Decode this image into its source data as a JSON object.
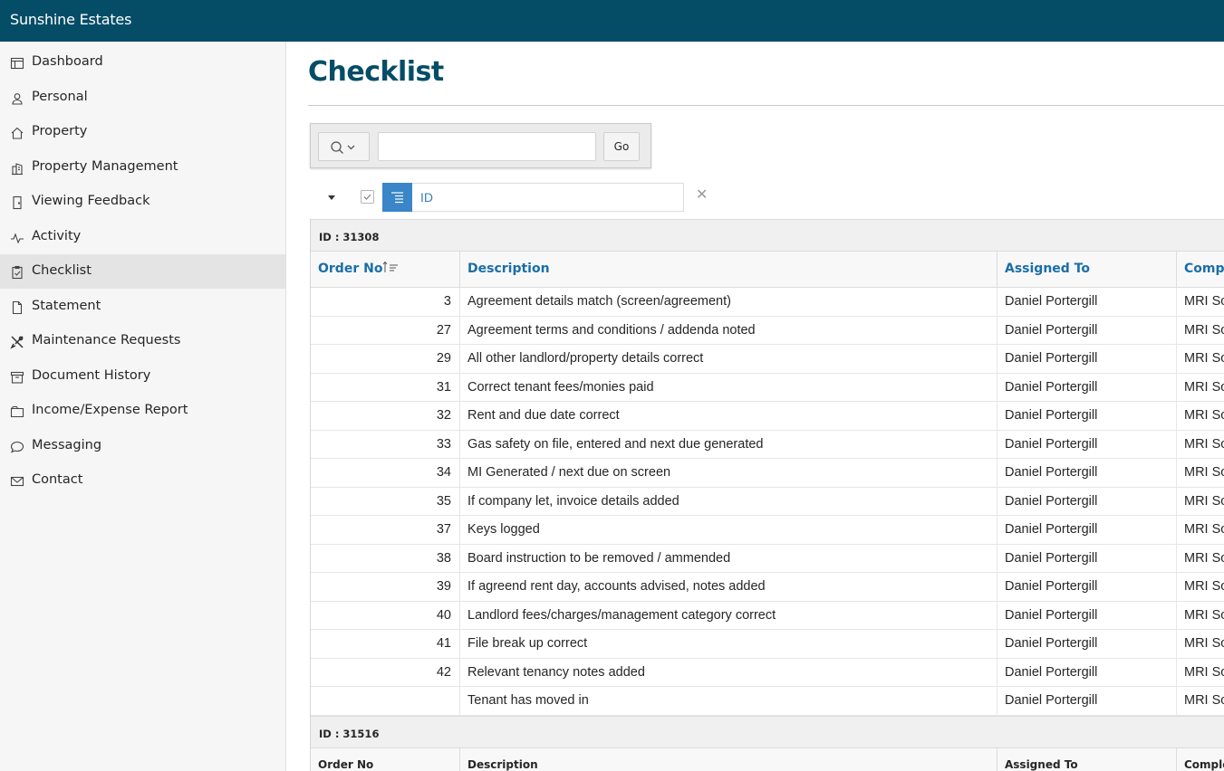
{
  "app": {
    "title": "Sunshine Estates"
  },
  "sidebar": {
    "items": [
      {
        "label": "Dashboard",
        "icon": "dashboard-icon",
        "active": false
      },
      {
        "label": "Personal",
        "icon": "user-icon",
        "active": false
      },
      {
        "label": "Property",
        "icon": "home-icon",
        "active": false
      },
      {
        "label": "Property Management",
        "icon": "building-icon",
        "active": false
      },
      {
        "label": "Viewing Feedback",
        "icon": "door-icon",
        "active": false
      },
      {
        "label": "Activity",
        "icon": "pulse-icon",
        "active": false
      },
      {
        "label": "Checklist",
        "icon": "clipboard-icon",
        "active": true
      },
      {
        "label": "Statement",
        "icon": "file-icon",
        "active": false
      },
      {
        "label": "Maintenance Requests",
        "icon": "tools-icon",
        "active": false
      },
      {
        "label": "Document History",
        "icon": "archive-icon",
        "active": false
      },
      {
        "label": "Income/Expense Report",
        "icon": "folder-icon",
        "active": false
      },
      {
        "label": "Messaging",
        "icon": "chat-icon",
        "active": false
      },
      {
        "label": "Contact",
        "icon": "mail-icon",
        "active": false
      }
    ]
  },
  "page": {
    "title": "Checklist"
  },
  "search": {
    "value": "",
    "go_label": "Go"
  },
  "filter": {
    "label": "ID",
    "checked": true
  },
  "columns": {
    "order": "Order No",
    "description": "Description",
    "assigned": "Assigned To",
    "completed": "Compl"
  },
  "groups": [
    {
      "header": "ID : 31308",
      "rows": [
        {
          "order": "3",
          "description": "Agreement details match (screen/agreement)",
          "assigned": "Daniel Portergill",
          "completed": "MRI So"
        },
        {
          "order": "27",
          "description": "Agreement terms and conditions / addenda noted",
          "assigned": "Daniel Portergill",
          "completed": "MRI So"
        },
        {
          "order": "29",
          "description": "All other landlord/property details correct",
          "assigned": "Daniel Portergill",
          "completed": "MRI So"
        },
        {
          "order": "31",
          "description": "Correct tenant fees/monies paid",
          "assigned": "Daniel Portergill",
          "completed": "MRI So"
        },
        {
          "order": "32",
          "description": "Rent and due date correct",
          "assigned": "Daniel Portergill",
          "completed": "MRI So"
        },
        {
          "order": "33",
          "description": "Gas safety on file, entered and next due generated",
          "assigned": "Daniel Portergill",
          "completed": "MRI So"
        },
        {
          "order": "34",
          "description": "MI Generated / next due on screen",
          "assigned": "Daniel Portergill",
          "completed": "MRI So"
        },
        {
          "order": "35",
          "description": "If company let, invoice details added",
          "assigned": "Daniel Portergill",
          "completed": "MRI So"
        },
        {
          "order": "37",
          "description": "Keys logged",
          "assigned": "Daniel Portergill",
          "completed": "MRI So"
        },
        {
          "order": "38",
          "description": "Board instruction to be removed / ammended",
          "assigned": "Daniel Portergill",
          "completed": "MRI So"
        },
        {
          "order": "39",
          "description": "If agreend rent day, accounts advised, notes added",
          "assigned": "Daniel Portergill",
          "completed": "MRI So"
        },
        {
          "order": "40",
          "description": "Landlord fees/charges/management category correct",
          "assigned": "Daniel Portergill",
          "completed": "MRI So"
        },
        {
          "order": "41",
          "description": "File break up correct",
          "assigned": "Daniel Portergill",
          "completed": "MRI So"
        },
        {
          "order": "42",
          "description": "Relevant tenancy notes added",
          "assigned": "Daniel Portergill",
          "completed": "MRI So"
        },
        {
          "order": "",
          "description": "Tenant has moved in",
          "assigned": "Daniel Portergill",
          "completed": "MRI So"
        }
      ]
    },
    {
      "header": "ID : 31516",
      "columns": {
        "order": "Order No",
        "description": "Description",
        "assigned": "Assigned To",
        "completed": "Comple"
      }
    }
  ],
  "colors": {
    "topbar": "#054d66",
    "title": "#054d66",
    "link": "#1a6ea8",
    "chip": "#3a86c8"
  }
}
